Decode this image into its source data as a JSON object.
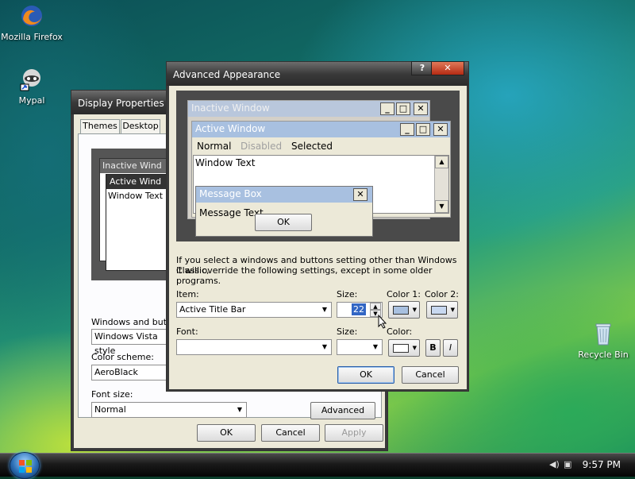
{
  "desktop": {
    "icons": [
      {
        "label": "Mozilla Firefox"
      },
      {
        "label": "Mypal"
      },
      {
        "label": "Recycle Bin"
      }
    ]
  },
  "taskbar": {
    "clock": "9:57 PM"
  },
  "display_properties": {
    "title": "Display Properties",
    "tabs": [
      "Themes",
      "Desktop"
    ],
    "preview": {
      "inactive_title": "Inactive Wind",
      "active_title": "Active Wind",
      "window_text": "Window Text"
    },
    "windows_and_buttons_label": "Windows and button",
    "windows_and_buttons_value": "Windows Vista style",
    "color_scheme_label": "Color scheme:",
    "color_scheme_value": "AeroBlack",
    "font_size_label": "Font size:",
    "font_size_value": "Normal",
    "advanced_button": "Advanced",
    "ok": "OK",
    "cancel": "Cancel",
    "apply": "Apply"
  },
  "advanced_appearance": {
    "title": "Advanced Appearance",
    "help_glyph": "?",
    "close_glyph": "✕",
    "preview": {
      "inactive_title": "Inactive Window",
      "active_title": "Active Window",
      "menu_normal": "Normal",
      "menu_disabled": "Disabled",
      "menu_selected": "Selected",
      "window_text": "Window Text",
      "msgbox_title": "Message Box",
      "msgbox_text": "Message Text",
      "msgbox_ok": "OK"
    },
    "info_text_1": "If you select a windows and buttons setting other than Windows Classic,",
    "info_text_2": "it will override the following settings, except in some older programs.",
    "item_label": "Item:",
    "item_value": "Active Title Bar",
    "size_label": "Size:",
    "size_value": "22",
    "color1_label": "Color 1:",
    "color2_label": "Color 2:",
    "font_label": "Font:",
    "font_value": "",
    "font_size_label": "Size:",
    "font_size_value": "",
    "font_color_label": "Color:",
    "bold_glyph": "B",
    "italic_glyph": "I",
    "ok": "OK",
    "cancel": "Cancel",
    "colors": {
      "color1": "#a8c0e0",
      "color2": "#c8d8f0",
      "font_color": "#ffffff"
    }
  }
}
